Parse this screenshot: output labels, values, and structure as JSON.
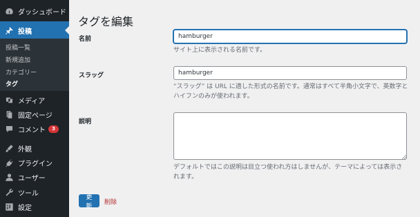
{
  "sidebar": {
    "dashboard": "ダッシュボード",
    "posts": "投稿",
    "posts_submenu": [
      "投稿一覧",
      "新規追加",
      "カテゴリー",
      "タグ"
    ],
    "media": "メディア",
    "pages": "固定ページ",
    "comments": "コメント",
    "comments_badge": "3",
    "appearance": "外観",
    "plugins": "プラグイン",
    "users": "ユーザー",
    "tools": "ツール",
    "settings": "設定"
  },
  "main": {
    "title": "タグを編集",
    "name": {
      "label": "名前",
      "value": "hamburger",
      "help": "サイト上に表示される名前です。"
    },
    "slug": {
      "label": "スラッグ",
      "value": "hamburger",
      "help": "“スラッグ” は URL に適した形式の名前です。通常はすべて半角小文字で、英数字とハイフンのみが使われます。"
    },
    "description": {
      "label": "説明",
      "value": "",
      "help": "デフォルトではこの説明は目立つ使われ方はしませんが、テーマによっては表示されます。"
    },
    "update_button": "更新",
    "delete_link": "削除"
  },
  "colors": {
    "sidebar_bg": "#1d2327",
    "accent": "#2271b1",
    "delete": "#b32d2e",
    "badge": "#d63638"
  }
}
